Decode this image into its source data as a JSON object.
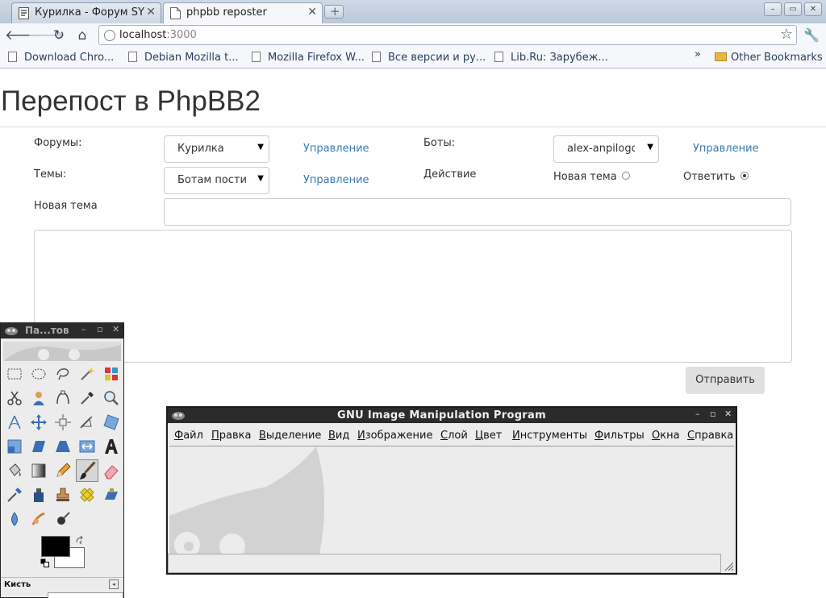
{
  "browser": {
    "tabs": [
      {
        "title": "Курилка - Форум SY",
        "active": false
      },
      {
        "title": "phpbb reposter",
        "active": true
      }
    ],
    "window_buttons": {
      "minimize": "–",
      "restore": "▭",
      "close": "✕"
    },
    "url_host": "localhost",
    "url_port": ":3000",
    "bookmarks": [
      "Download Chro...",
      "Debian Mozilla t...",
      "Mozilla Firefox W...",
      "Все версии и ру...",
      "Lib.Ru: Зарубеж..."
    ],
    "bookmarks_overflow": "»",
    "other_bookmarks": "Other Bookmarks"
  },
  "page": {
    "title": "Перепост в PhpBB2",
    "forums_label": "Форумы:",
    "forums_selected": "Курилка",
    "forums_manage": "Управление",
    "bots_label": "Боты:",
    "bots_selected": "alex-anpilogov",
    "bots_manage": "Управление",
    "topics_label": "Темы:",
    "topics_selected": "Ботам пости",
    "topics_manage": "Управление",
    "action_label": "Действие",
    "action_new_topic": "Новая тема",
    "action_reply": "Ответить",
    "action_selected": "reply",
    "new_topic_label": "Новая тема",
    "new_topic_value": "",
    "message_value": "",
    "submit_label": "Отправить"
  },
  "gimp_toolbox": {
    "title": "Па...тов",
    "brush_label": "Кисть",
    "fg_color": "#000000",
    "bg_color": "#ffffff"
  },
  "gimp_main": {
    "title": "GNU Image Manipulation Program",
    "menus": [
      "Файл",
      "Правка",
      "Выделение",
      "Вид",
      "Изображение",
      "Слой",
      "Цвет",
      "Инструменты",
      "Фильтры",
      "Окна",
      "Справка"
    ]
  }
}
